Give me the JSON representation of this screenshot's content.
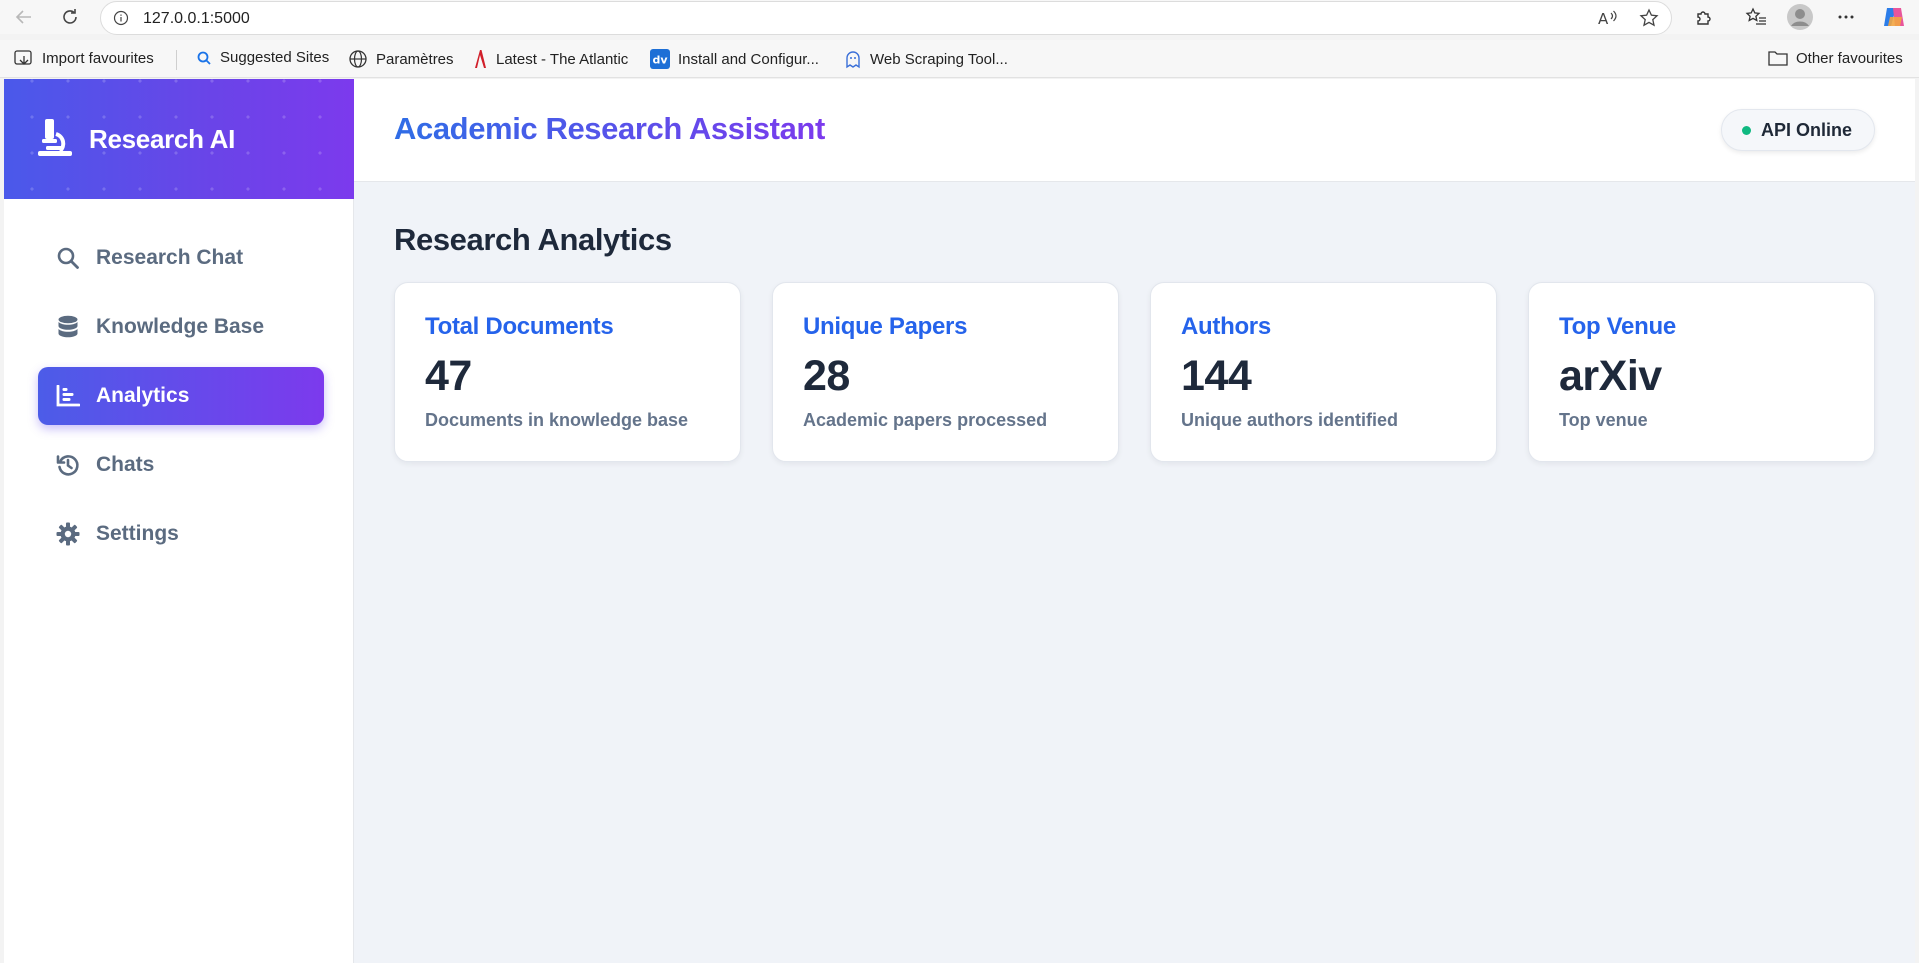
{
  "browser": {
    "url": "127.0.0.1:5000",
    "bookmarks": [
      {
        "label": "Import favourites",
        "icon": "import-icon"
      },
      {
        "label": "Suggested Sites",
        "icon": "search-icon"
      },
      {
        "label": "Paramètres",
        "icon": "globe-icon"
      },
      {
        "label": "Latest - The Atlantic",
        "icon": "atlantic-logo-icon"
      },
      {
        "label": "Install and Configur...",
        "icon": "dv-logo-icon"
      },
      {
        "label": "Web Scraping Tool...",
        "icon": "scraper-icon"
      }
    ],
    "other_favourites": "Other favourites"
  },
  "sidebar": {
    "brand": "Research AI",
    "items": [
      {
        "label": "Research Chat",
        "icon": "search-icon",
        "active": false
      },
      {
        "label": "Knowledge Base",
        "icon": "database-icon",
        "active": false
      },
      {
        "label": "Analytics",
        "icon": "chart-icon",
        "active": true
      },
      {
        "label": "Chats",
        "icon": "history-icon",
        "active": false
      },
      {
        "label": "Settings",
        "icon": "gear-icon",
        "active": false
      }
    ]
  },
  "header": {
    "title": "Academic Research Assistant",
    "status": "API Online"
  },
  "main": {
    "section_title": "Research Analytics",
    "cards": [
      {
        "title": "Total Documents",
        "value": "47",
        "desc": "Documents in knowledge base"
      },
      {
        "title": "Unique Papers",
        "value": "28",
        "desc": "Academic papers processed"
      },
      {
        "title": "Authors",
        "value": "144",
        "desc": "Unique authors identified"
      },
      {
        "title": "Top Venue",
        "value": "arXiv",
        "desc": "Top venue"
      }
    ]
  },
  "colors": {
    "accent_blue": "#2563eb",
    "accent_purple": "#7c3aed",
    "status_green": "#10b981"
  }
}
